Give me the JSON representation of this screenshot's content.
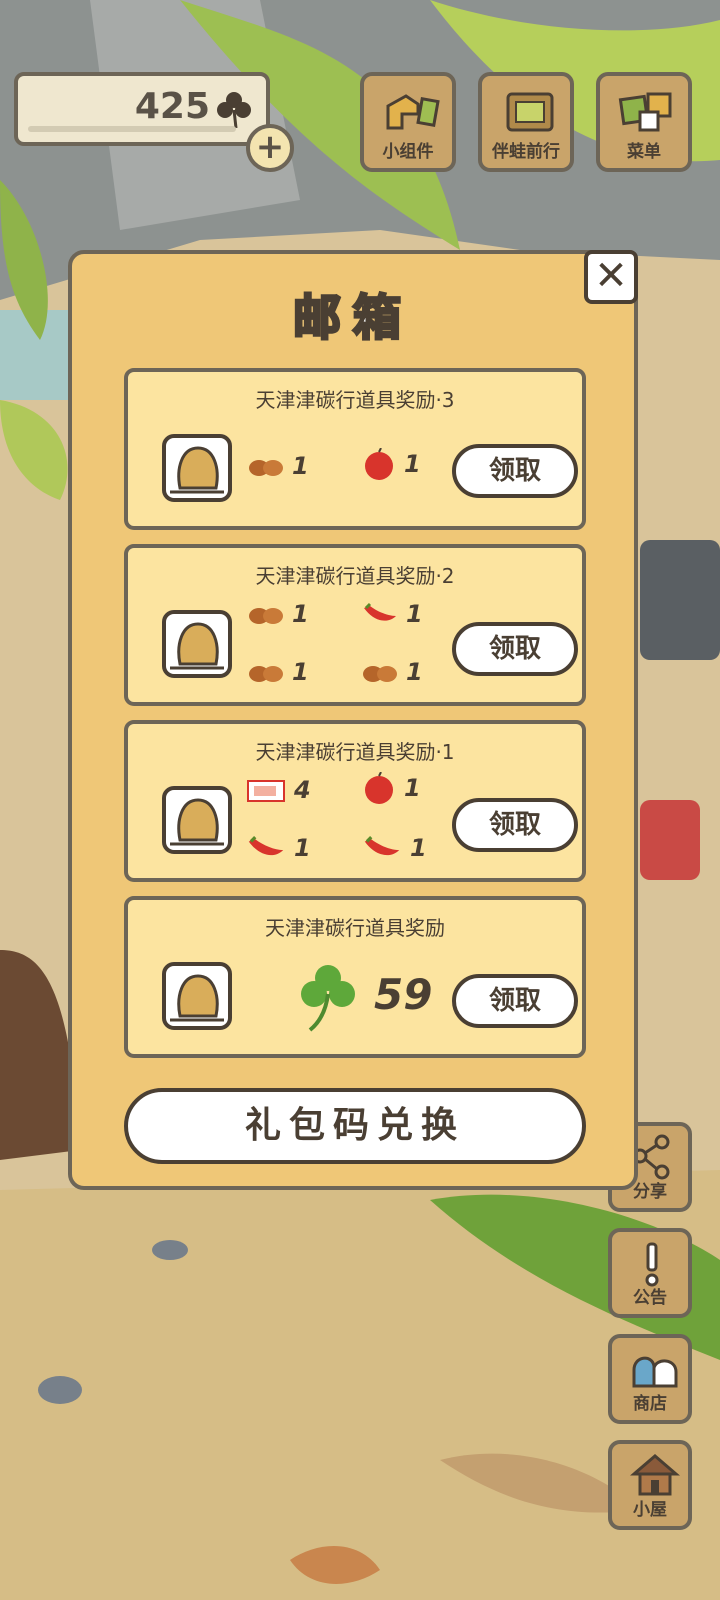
{
  "header": {
    "clover_count": "425",
    "add_button": "+"
  },
  "top_buttons": [
    {
      "label": "小组件",
      "icon": "widget-icon"
    },
    {
      "label": "伴蛙前行",
      "icon": "journey-icon"
    },
    {
      "label": "菜单",
      "icon": "menu-icon"
    }
  ],
  "side_buttons": [
    {
      "label": "分享",
      "icon": "share-icon"
    },
    {
      "label": "公告",
      "icon": "notice-icon"
    },
    {
      "label": "商店",
      "icon": "shop-icon"
    },
    {
      "label": "小屋",
      "icon": "house-icon"
    }
  ],
  "mailbox": {
    "title": "邮箱",
    "close_label": "✕",
    "claim_label": "领取",
    "gift_code_label": "礼包码兑换",
    "mails": [
      {
        "title": "天津津碳行道具奖励·3",
        "items": [
          {
            "icon": "chestnut-icon",
            "count": "1"
          },
          {
            "icon": "apple-icon",
            "count": "1"
          }
        ]
      },
      {
        "title": "天津津碳行道具奖励·2",
        "items": [
          {
            "icon": "chestnut-icon",
            "count": "1"
          },
          {
            "icon": "chili-icon",
            "count": "1"
          },
          {
            "icon": "chestnut-icon",
            "count": "1"
          },
          {
            "icon": "chestnut-icon",
            "count": "1"
          }
        ]
      },
      {
        "title": "天津津碳行道具奖励·1",
        "items": [
          {
            "icon": "ticket-icon",
            "count": "4"
          },
          {
            "icon": "apple-icon",
            "count": "1"
          },
          {
            "icon": "chili-icon",
            "count": "1"
          },
          {
            "icon": "chili-icon",
            "count": "1"
          }
        ]
      },
      {
        "title": "天津津碳行道具奖励",
        "items": [
          {
            "icon": "clover-icon",
            "count": "59"
          }
        ]
      }
    ]
  },
  "colors": {
    "panel": "#efc777",
    "card": "#fce4a0",
    "outline": "#4a3f33",
    "wood": "#c9a46a"
  }
}
